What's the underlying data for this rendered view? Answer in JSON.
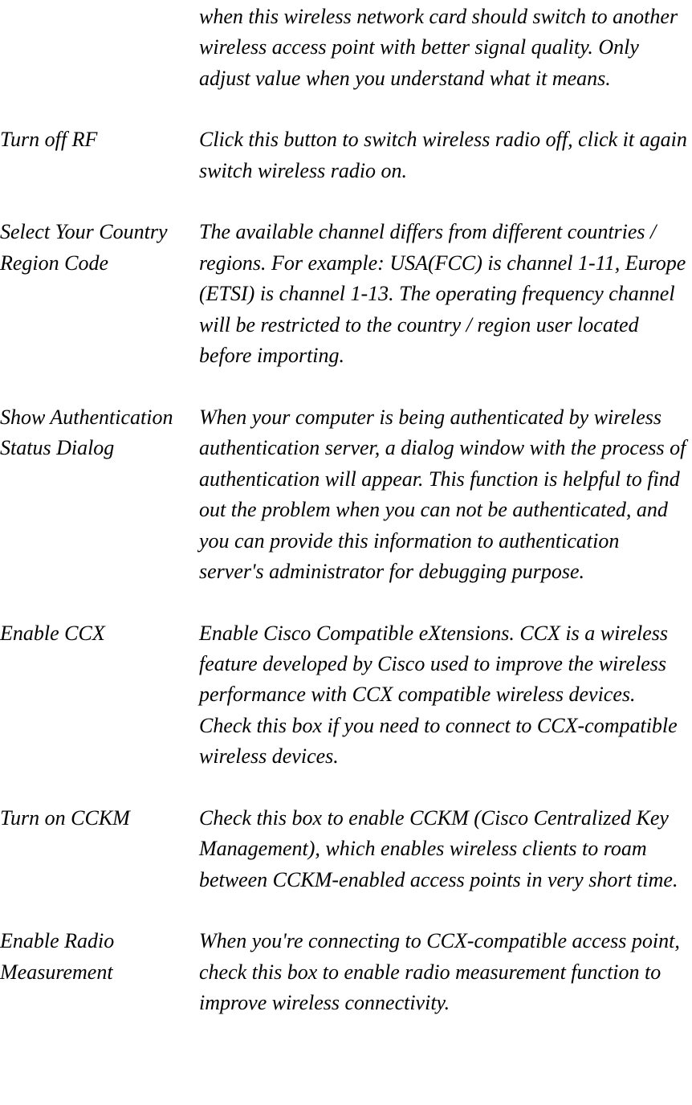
{
  "entries": [
    {
      "term": "",
      "desc": "when this wireless network card should switch to another wireless access point with better signal quality. Only adjust value when you understand what it means."
    },
    {
      "term": "Turn off RF",
      "desc": "Click this button to switch wireless radio off, click it again switch wireless radio on."
    },
    {
      "term": "Select Your Country Region Code",
      "desc": "The available channel differs from different countries / regions. For example: USA(FCC) is channel 1-11, Europe (ETSI) is channel 1-13. The operating frequency channel will be restricted to the country / region user located before importing."
    },
    {
      "term": "Show Authentication Status Dialog",
      "desc": "When your computer is being authenticated by wireless authentication server, a dialog window with the process of authentication will appear. This function is helpful to find out the problem when you can not be authenticated, and you can provide this information to authentication server's administrator for debugging purpose."
    },
    {
      "term": "Enable CCX",
      "desc": "Enable Cisco Compatible eXtensions. CCX is a wireless feature developed by Cisco used to improve the wireless performance with CCX compatible wireless devices. Check this box if you need to connect to CCX-compatible wireless devices."
    },
    {
      "term": "Turn on CCKM",
      "desc": "Check this box to enable CCKM (Cisco Centralized Key Management), which enables wireless clients to roam between CCKM-enabled access points in very short time."
    },
    {
      "term": "Enable Radio Measurement",
      "desc": "When you're connecting to CCX-compatible access point, check this box to enable radio measurement function to improve wireless connectivity."
    }
  ]
}
